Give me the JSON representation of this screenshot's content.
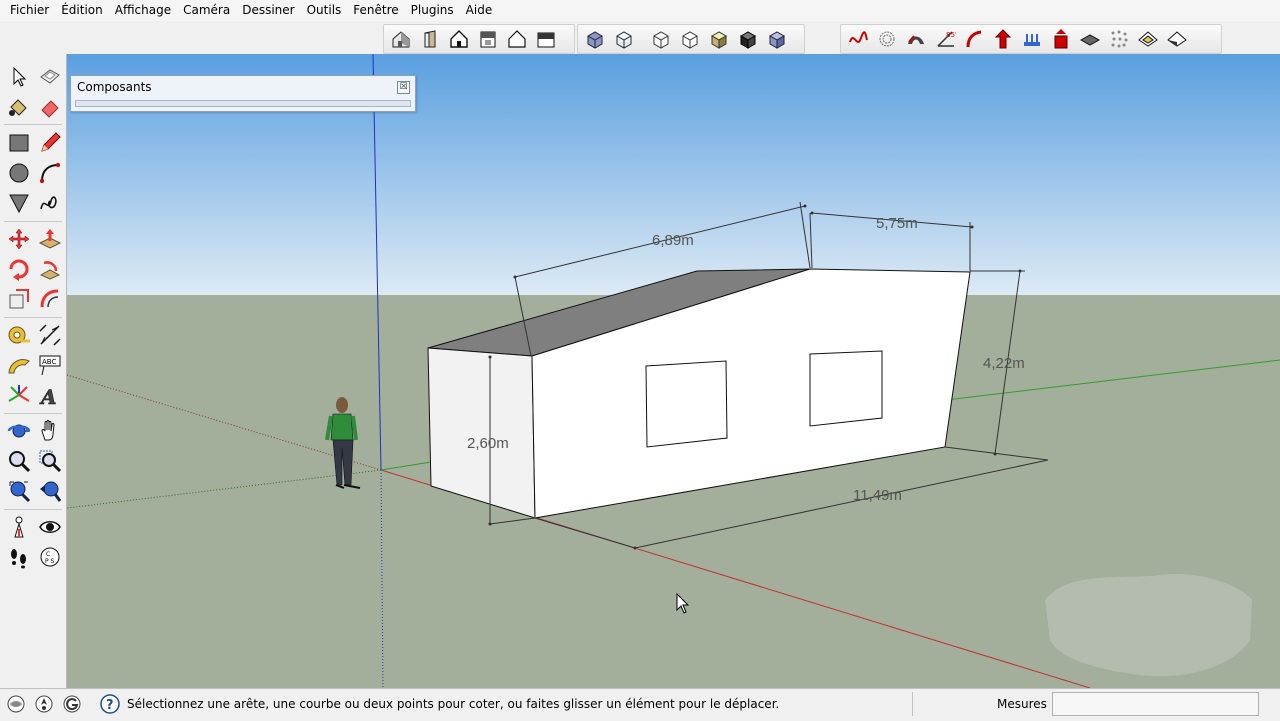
{
  "menu": [
    "Fichier",
    "Édition",
    "Affichage",
    "Caméra",
    "Dessiner",
    "Outils",
    "Fenêtre",
    "Plugins",
    "Aide"
  ],
  "panel": {
    "title": "Composants",
    "close_glyph": "☒"
  },
  "dimensions": {
    "top_left": "6,89m",
    "top_right": "5,75m",
    "height_right": "4,22m",
    "height_left": "2,60m",
    "length": "11,49m"
  },
  "status": {
    "message": "Sélectionnez une arête, une courbe ou deux points pour coter, ou faites glisser un élément pour le déplacer.",
    "measures_label": "Mesures",
    "measures_value": ""
  },
  "colors": {
    "sky_top": "#5a9fe0",
    "sky_bottom": "#ddeaf4",
    "ground": "#a3ae9b",
    "red_axis": "#c03030",
    "green_axis": "#2ea02e",
    "blue_axis": "#2030c0",
    "roof": "#7f7f7f"
  },
  "icons": {
    "top_toolbar": [
      "house-iso-icon",
      "house-front-icon",
      "house-top-icon",
      "house-right-icon",
      "house-back-icon",
      "house-left-icon",
      "xray-icon",
      "wireframe-icon",
      "hidden-line-icon",
      "shaded-icon",
      "shaded-texture-icon",
      "monochrome-icon",
      "section-plane-icon",
      "curve-icon",
      "smooth-icon",
      "bend-icon",
      "angle-icon",
      "arc-curve-icon",
      "push-up-icon",
      "array-icon",
      "extrude-icon",
      "flatten-icon",
      "scatter-icon",
      "fold-icon",
      "unfold-icon"
    ],
    "left_toolbar": [
      "select-icon",
      "eraser-eraser-icon",
      "paint-bucket-icon",
      "eraser-icon",
      "rectangle-icon",
      "pencil-icon",
      "circle-icon",
      "arc-icon",
      "polygon-icon",
      "freehand-icon",
      "move-icon",
      "push-pull-icon",
      "rotate-icon",
      "follow-me-icon",
      "scale-icon",
      "offset-icon",
      "tape-measure-icon",
      "dimension-icon",
      "protractor-icon",
      "text-icon",
      "axes-icon",
      "3d-text-icon",
      "orbit-icon",
      "pan-icon",
      "zoom-icon",
      "zoom-window-icon",
      "zoom-extents-icon",
      "previous-view-icon",
      "position-camera-icon",
      "look-around-icon",
      "walk-icon",
      "section-icon"
    ]
  }
}
